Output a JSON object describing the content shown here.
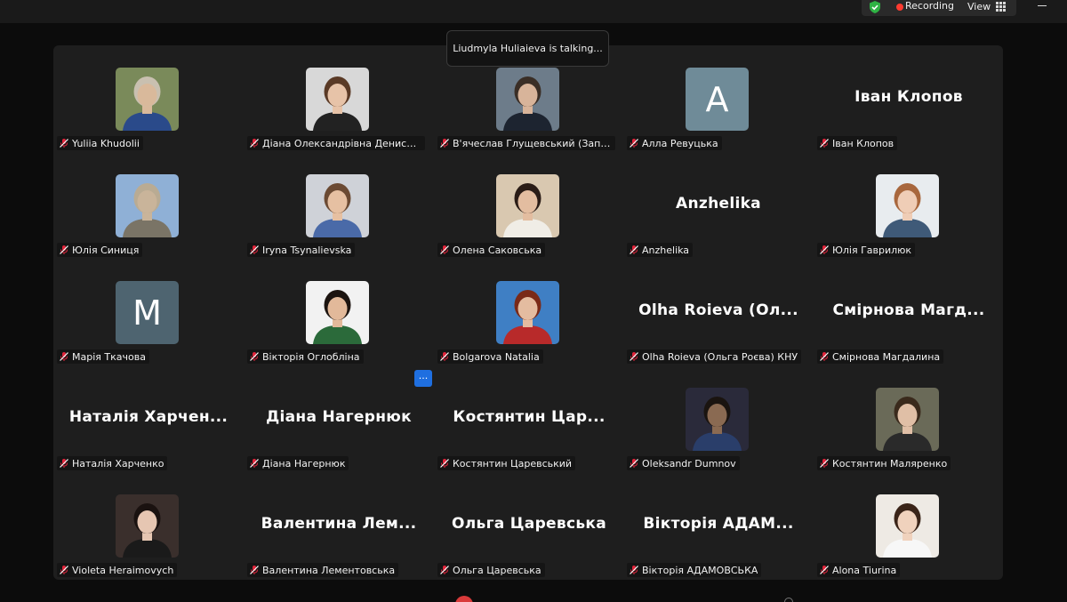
{
  "topbar": {
    "recording_label": "Recording",
    "view_label": "View",
    "icons": {
      "security": "shield-check-icon",
      "view": "grid-icon",
      "minimize": "minimize-icon"
    },
    "colors": {
      "shield": "#2fb344",
      "record": "#ff3b30"
    }
  },
  "toast": {
    "text": "Liudmyla Huliaieva is talking..."
  },
  "more_button": {
    "label": "···"
  },
  "colors": {
    "muted_mic": "#e0243a",
    "more_button": "#1f6fe0",
    "letter_avatar_a": "#6f8b98",
    "letter_avatar_m": "#4e6470"
  },
  "participants": [
    {
      "name": "Yuliia Khudolii",
      "kind": "photo",
      "bg": "#7a8a5a",
      "skin": "#d9b99b",
      "hair": "#c9c0b0",
      "cloth": "#2a4a8a"
    },
    {
      "name": "Діана Олександрівна Денисенко",
      "kind": "photo",
      "bg": "#d8d8d8",
      "skin": "#e7c3a8",
      "hair": "#5a3a26",
      "cloth": "#222222"
    },
    {
      "name": "В'ячеслав Глущевський (Запорізьки...",
      "kind": "photo",
      "bg": "#6d7c8a",
      "skin": "#d8b49a",
      "hair": "#3a2e26",
      "cloth": "#1d2430"
    },
    {
      "name": "Алла Ревуцька",
      "kind": "letter",
      "letter": "A",
      "color": "#6f8b98"
    },
    {
      "name": "Іван Клопов",
      "kind": "text",
      "display": "Іван Клопов"
    },
    {
      "name": "Юлія Синиця",
      "kind": "photo",
      "bg": "#8fb0d6",
      "skin": "#c9b49a",
      "hair": "#b9ab93",
      "cloth": "#7a7466"
    },
    {
      "name": "Iryna Tsynalievska",
      "kind": "photo",
      "bg": "#cfd2d8",
      "skin": "#e6c0a2",
      "hair": "#6b4a33",
      "cloth": "#4a6aa8"
    },
    {
      "name": "Олена Саковська",
      "kind": "photo",
      "bg": "#d9c8b0",
      "skin": "#e3bda0",
      "hair": "#2a1c16",
      "cloth": "#f0ede6"
    },
    {
      "name": "Anzhelika",
      "kind": "text",
      "display": "Anzhelika"
    },
    {
      "name": "Юлія Гаврилюк",
      "kind": "photo",
      "bg": "#e8ecef",
      "skin": "#efcdb6",
      "hair": "#a8673d",
      "cloth": "#3f5a78"
    },
    {
      "name": "Марія Ткачова",
      "kind": "letter",
      "letter": "M",
      "color": "#4e6470"
    },
    {
      "name": "Вікторія Оглобліна",
      "kind": "photo",
      "bg": "#f2f2f2",
      "skin": "#e2b99a",
      "hair": "#1c1410",
      "cloth": "#2b6a3a"
    },
    {
      "name": "Bolgarova Natalia",
      "kind": "photo",
      "bg": "#3f7fc4",
      "skin": "#e4bca0",
      "hair": "#7a2a18",
      "cloth": "#b82a2a"
    },
    {
      "name": "Olha Roieva (Ольга Роєва) КНУ",
      "kind": "text",
      "display": "Olha Roieva (Ол..."
    },
    {
      "name": "Смірнова Магдалина",
      "kind": "text",
      "display": "Смірнова Магд..."
    },
    {
      "name": "Наталія Харченко",
      "kind": "text",
      "display": "Наталія Харчен..."
    },
    {
      "name": "Діана Нагернюк",
      "kind": "text",
      "display": "Діана Нагернюк"
    },
    {
      "name": "Костянтин Царевський",
      "kind": "text",
      "display": "Костянтин Цар..."
    },
    {
      "name": "Oleksandr Dumnov",
      "kind": "photo",
      "bg": "#2a2a3a",
      "skin": "#8a6a52",
      "hair": "#1a1410",
      "cloth": "#2a3e6a"
    },
    {
      "name": "Костянтин Маляренко",
      "kind": "photo",
      "bg": "#6a6a58",
      "skin": "#e0bfa6",
      "hair": "#3a2a1c",
      "cloth": "#2a2a2a"
    },
    {
      "name": "Violeta Heraimovych",
      "kind": "photo",
      "bg": "#3a2f2c",
      "skin": "#e6c6b2",
      "hair": "#1a1210",
      "cloth": "#1a1a1a"
    },
    {
      "name": "Валентина Лементовська",
      "kind": "text",
      "display": "Валентина Лем..."
    },
    {
      "name": "Ольга Царевська",
      "kind": "text",
      "display": "Ольга Царевська"
    },
    {
      "name": "Вікторія АДАМОВСЬКА",
      "kind": "text",
      "display": "Вікторія АДАМ..."
    },
    {
      "name": "Alona Tiurina",
      "kind": "photo",
      "bg": "#eeeae4",
      "skin": "#f0d2bd",
      "hair": "#3a2418",
      "cloth": "#f7f7f7"
    }
  ]
}
